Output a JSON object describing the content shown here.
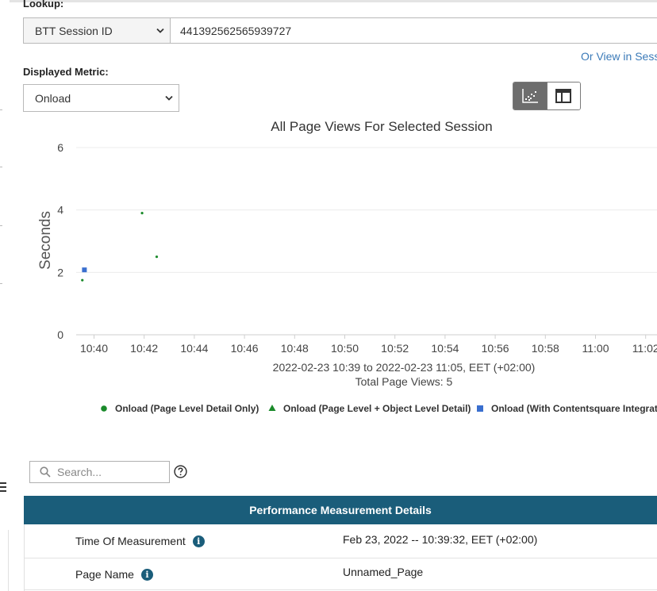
{
  "lookup": {
    "label": "Lookup:",
    "type_selected": "BTT Session ID",
    "session_value": "441392562565939727",
    "or_view_link": "Or View in Sess"
  },
  "metric": {
    "label": "Displayed Metric:",
    "selected": "Onload"
  },
  "view_toggle": {
    "icons": [
      "scatter-chart-icon",
      "table-layout-icon"
    ],
    "active": "scatter-chart-icon"
  },
  "chart_data": {
    "type": "scatter",
    "title": "All Page Views For Selected Session",
    "ylabel": "Seconds",
    "xlabel": "2022-02-23 10:39 to 2022-02-23 11:05, EET (+02:00)",
    "subtitle": "Total Page Views: 5",
    "ylim": [
      0,
      6
    ],
    "yticks": [
      "0",
      "2",
      "4",
      "6"
    ],
    "xticks": [
      "10:40",
      "10:42",
      "10:44",
      "10:46",
      "10:48",
      "10:50",
      "10:52",
      "10:54",
      "10:56",
      "10:58",
      "11:00",
      "11:02"
    ],
    "grid": true,
    "legend_position": "bottom",
    "series": [
      {
        "name": "Onload (Page Level Detail Only)",
        "marker": "circle",
        "color": "#1a8a2a",
        "points": [
          {
            "x": "10:39:32",
            "y": 1.75
          },
          {
            "x": "10:41:55",
            "y": 3.9
          },
          {
            "x": "10:42:30",
            "y": 2.5
          }
        ]
      },
      {
        "name": "Onload (Page Level + Object Level Detail)",
        "marker": "triangle",
        "color": "#1a8a2a",
        "points": []
      },
      {
        "name": "Onload (With Contentsquare Integration",
        "marker": "square",
        "color": "#3a6fcf",
        "points": [
          {
            "x": "10:39:37",
            "y": 2.08
          }
        ]
      }
    ]
  },
  "search": {
    "placeholder": "Search..."
  },
  "table": {
    "header": "Performance Measurement Details",
    "rows": [
      {
        "label": "Time Of Measurement",
        "value": "Feb 23, 2022 -- 10:39:32, EET (+02:00)"
      },
      {
        "label": "Page Name",
        "value": "Unnamed_Page"
      }
    ]
  },
  "colors": {
    "table_header": "#1a5d7a",
    "link": "#3b7ab8",
    "series_green": "#1a8a2a",
    "series_blue": "#3a6fcf"
  }
}
